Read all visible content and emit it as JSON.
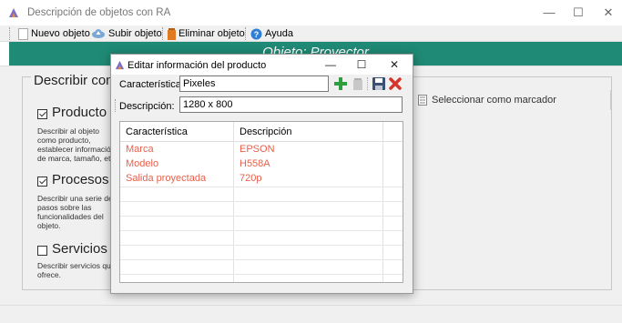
{
  "window": {
    "title": "Descripción de objetos con RA",
    "minimize": "—",
    "maximize": "☐",
    "close": "✕"
  },
  "toolbar": {
    "items": [
      {
        "label": "Nuevo objeto",
        "icon": "document-icon"
      },
      {
        "label": "Subir objeto",
        "icon": "cloud-upload-icon"
      },
      {
        "label": "Eliminar objeto",
        "icon": "trash-icon"
      },
      {
        "label": "Ayuda",
        "icon": "help-icon"
      }
    ]
  },
  "banner": {
    "title": "Objeto: Proyector"
  },
  "main": {
    "group_title": "Describir como",
    "sections": [
      {
        "title": "Producto",
        "checked": true,
        "desc": "Describir al objeto como producto, establecer información de marca, tamaño, etc."
      },
      {
        "title": "Procesos",
        "checked": true,
        "desc": "Describir una serie de pasos sobre las funcionalidades del objeto."
      },
      {
        "title": "Servicios",
        "checked": false,
        "desc": "Describir servicios que ofrece."
      }
    ],
    "marker_button": "Seleccionar como marcador"
  },
  "dialog": {
    "title": "Editar información del producto",
    "minimize": "—",
    "maximize": "☐",
    "close": "✕",
    "caracteristica_label": "Característica:",
    "caracteristica_value": "Pixeles",
    "descripcion_label": "Descripción:",
    "descripcion_value": "1280 x 800",
    "grid": {
      "columns": [
        "Característica",
        "Descripción"
      ],
      "rows": [
        [
          "Marca",
          "EPSON"
        ],
        [
          "Modelo",
          "H558A"
        ],
        [
          "Salida proyectada",
          "720p"
        ]
      ]
    }
  },
  "colors": {
    "banner": "#1f8a75",
    "row_text": "#e8604c",
    "add_icon": "#2e9e3e",
    "delete_icon": "#d9342b"
  }
}
